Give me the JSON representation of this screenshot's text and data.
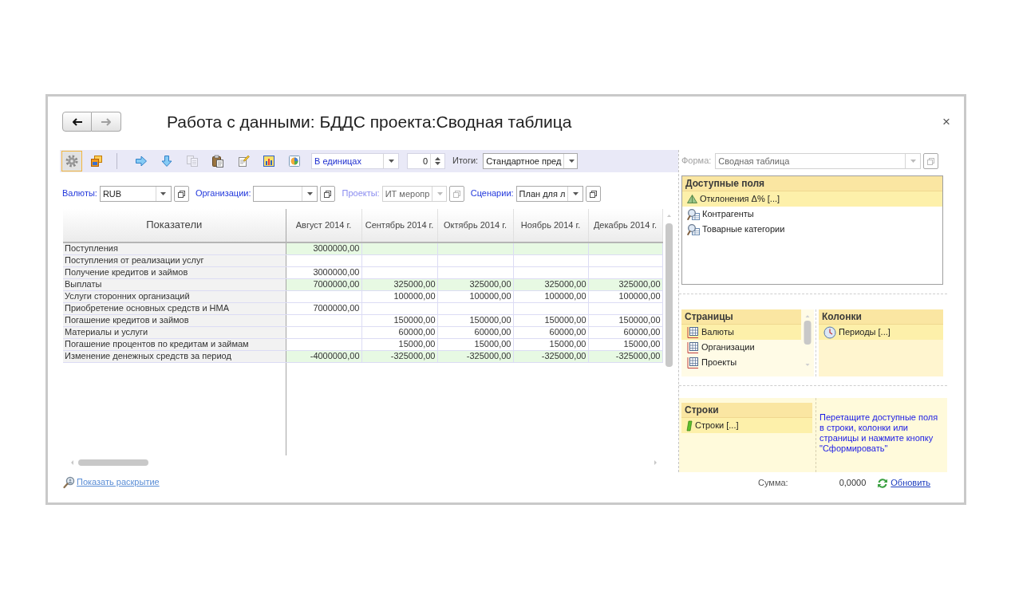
{
  "window": {
    "title": "Работа с данными: БДДС проекта:Сводная таблица",
    "close": "×",
    "back_disabled": false,
    "forward_disabled": true
  },
  "toolbar": {
    "button_groups": [
      [
        {
          "kind": "settings",
          "pressed": true,
          "disabled": false
        },
        {
          "kind": "windows",
          "pressed": false,
          "disabled": false
        }
      ],
      [
        {
          "kind": "right",
          "pressed": false,
          "disabled": false
        },
        {
          "kind": "down",
          "pressed": false,
          "disabled": false
        },
        {
          "kind": "copy",
          "pressed": false,
          "disabled": true
        },
        {
          "kind": "paste",
          "pressed": false,
          "disabled": false
        },
        {
          "kind": "note",
          "pressed": false,
          "disabled": false
        },
        {
          "kind": "chart",
          "pressed": false,
          "disabled": false
        },
        {
          "kind": "pie",
          "pressed": false,
          "disabled": false
        }
      ]
    ],
    "units": "В единицах",
    "precision": "0",
    "totals_label": "Итоги:",
    "totals": "Стандартное пред"
  },
  "filters": [
    {
      "label": "Валюты:",
      "value": "RUB",
      "disabled": false
    },
    {
      "label": "Организации:",
      "disabled": false
    },
    {
      "label": "Проекты:",
      "value": "ИТ меропр",
      "disabled": true
    },
    {
      "label": "Сценарии:",
      "value": "План для л",
      "disabled": false
    }
  ],
  "table": {
    "columns": [
      "Показатели",
      "Август 2014 г.",
      "Сентябрь 2014 г.",
      "Октябрь 2014 г.",
      "Ноябрь 2014 г.",
      "Декабрь 2014 г."
    ],
    "rows": [
      {
        "kind": "group",
        "cells": [
          "Поступления",
          "3000000,00",
          null,
          null,
          null,
          null
        ]
      },
      {
        "kind": "item",
        "cells": [
          "Поступления от реализации услуг",
          null,
          null,
          null,
          null,
          null
        ]
      },
      {
        "kind": "item",
        "cells": [
          "Получение кредитов и займов",
          "3000000,00",
          null,
          null,
          null,
          null
        ]
      },
      {
        "kind": "group",
        "cells": [
          "Выплаты",
          "7000000,00",
          "325000,00",
          "325000,00",
          "325000,00",
          "325000,00"
        ]
      },
      {
        "kind": "item",
        "cells": [
          "Услуги сторонних организаций",
          null,
          "100000,00",
          "100000,00",
          "100000,00",
          "100000,00"
        ]
      },
      {
        "kind": "item",
        "cells": [
          "Приобретение основных средств и НМА",
          "7000000,00",
          null,
          null,
          null,
          null
        ]
      },
      {
        "kind": "item",
        "cells": [
          "Погашение кредитов и займов",
          null,
          "150000,00",
          "150000,00",
          "150000,00",
          "150000,00"
        ]
      },
      {
        "kind": "item",
        "cells": [
          "Материалы и услуги",
          null,
          "60000,00",
          "60000,00",
          "60000,00",
          "60000,00"
        ]
      },
      {
        "kind": "item",
        "cells": [
          "Погашение процентов по кредитам и займам",
          null,
          "15000,00",
          "15000,00",
          "15000,00",
          "15000,00"
        ]
      },
      {
        "kind": "group",
        "cells": [
          "Изменение денежных средств за период",
          "-4000000,00",
          "-325000,00",
          "-325000,00",
          "-325000,00",
          "-325000,00"
        ]
      }
    ]
  },
  "show_details_link": "Показать раскрытие",
  "form": {
    "label": "Форма:",
    "value": "Сводная таблица",
    "disabled": true
  },
  "available_fields": {
    "title": "Доступные поля",
    "items": [
      {
        "kind": "indicator",
        "label": "Отклонения Δ% [...]",
        "selected": true
      },
      {
        "kind": "dimension",
        "label": "Контрагенты",
        "selected": false
      },
      {
        "kind": "dimension",
        "label": "Товарные категории",
        "selected": false
      }
    ]
  },
  "pages": {
    "title": "Страницы",
    "items": [
      {
        "kind": "page",
        "label": "Валюты",
        "selected": true
      },
      {
        "kind": "page",
        "label": "Организации",
        "selected": false
      },
      {
        "kind": "page",
        "label": "Проекты",
        "selected": false
      }
    ]
  },
  "columns_area": {
    "title": "Колонки",
    "items": [
      {
        "kind": "period",
        "label": "Периоды [...]",
        "selected": true
      }
    ]
  },
  "rows_area": {
    "title": "Строки",
    "items": [
      {
        "kind": "rows",
        "label": "Строки [...]",
        "selected": true
      }
    ]
  },
  "hint": "Перетащите доступные поля в строки, колонки или страницы и нажмите кнопку \"Сформировать\"",
  "summary": {
    "label": "Сумма:",
    "value": "0,0000",
    "refresh": "Обновить"
  }
}
